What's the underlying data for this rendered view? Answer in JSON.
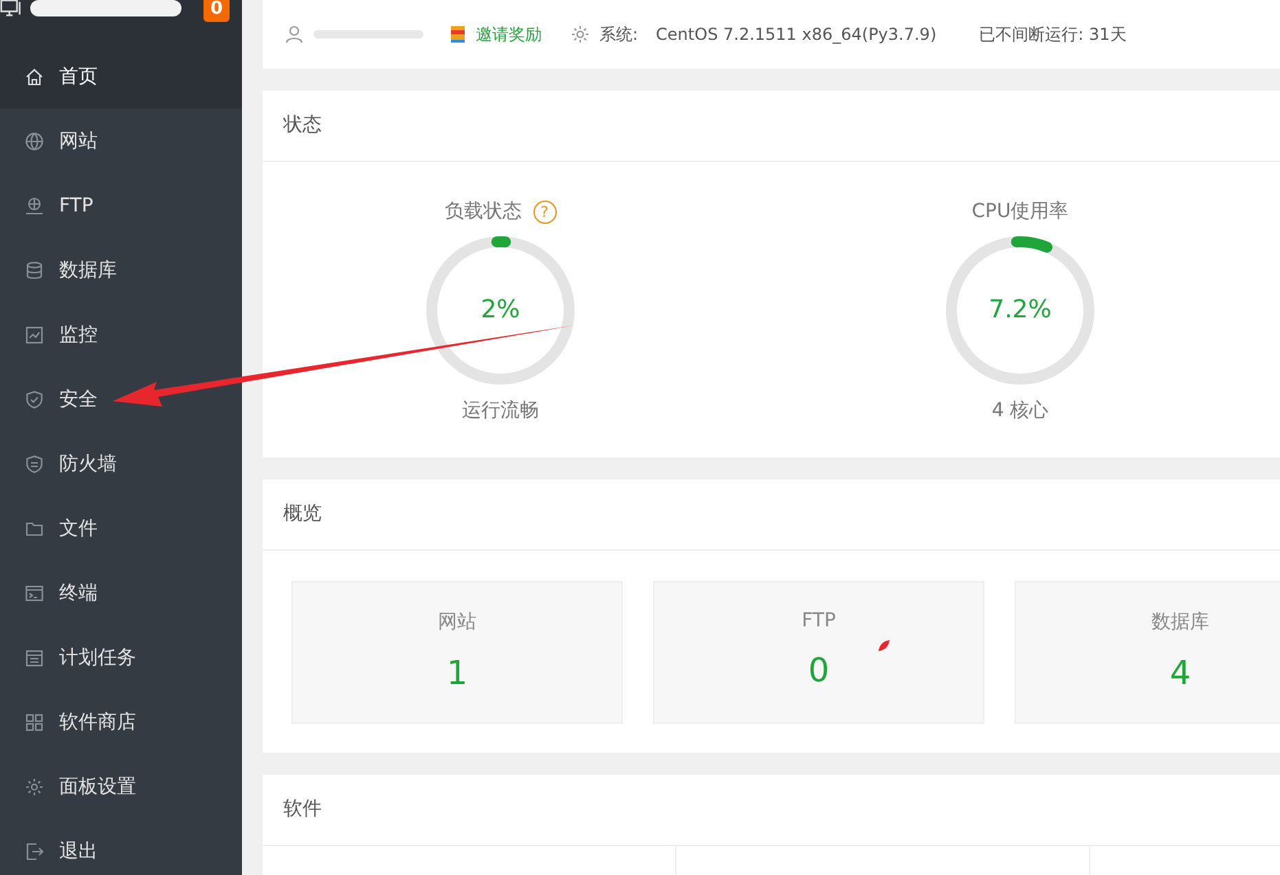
{
  "sidebar": {
    "badge": "0",
    "items": [
      {
        "label": "首页",
        "selected": true
      },
      {
        "label": "网站",
        "selected": false
      },
      {
        "label": "FTP",
        "selected": false
      },
      {
        "label": "数据库",
        "selected": false
      },
      {
        "label": "监控",
        "selected": false
      },
      {
        "label": "安全",
        "selected": false
      },
      {
        "label": "防火墙",
        "selected": false
      },
      {
        "label": "文件",
        "selected": false
      },
      {
        "label": "终端",
        "selected": false
      },
      {
        "label": "计划任务",
        "selected": false
      },
      {
        "label": "软件商店",
        "selected": false
      },
      {
        "label": "面板设置",
        "selected": false
      },
      {
        "label": "退出",
        "selected": false
      }
    ]
  },
  "header": {
    "invite": "邀请奖励",
    "system_label": "系统:",
    "system": "CentOS 7.2.1511 x86_64(Py3.7.9)",
    "uptime": "已不间断运行: 31天"
  },
  "status": {
    "title": "状态",
    "gauges": [
      {
        "title": "负载状态",
        "help": "?",
        "value": "2%",
        "level": 0.02,
        "caption": "运行流畅"
      },
      {
        "title": "CPU使用率",
        "value": "7.2%",
        "level": 0.072,
        "caption": "4 核心"
      }
    ]
  },
  "overview": {
    "title": "概览",
    "stats": [
      {
        "label": "网站",
        "value": "1"
      },
      {
        "label": "FTP",
        "value": "0"
      },
      {
        "label": "数据库",
        "value": "4"
      }
    ]
  },
  "software": {
    "title": "软件"
  }
}
